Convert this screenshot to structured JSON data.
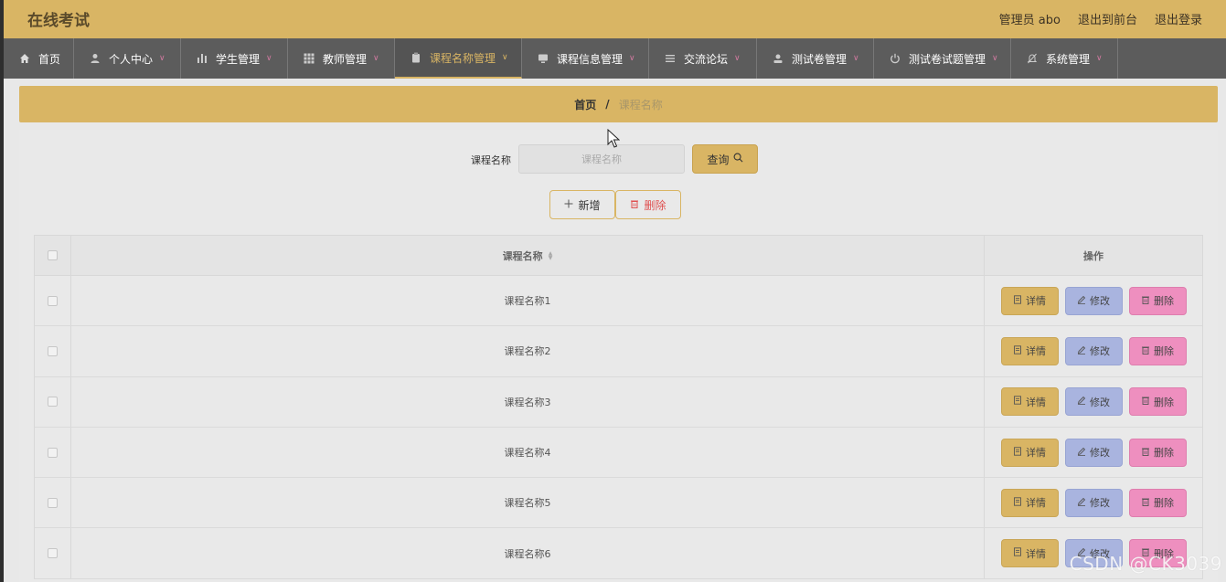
{
  "header": {
    "title": "在线考试",
    "user_label": "管理员 abo",
    "back_label": "退出到前台",
    "logout_label": "退出登录"
  },
  "nav": {
    "items": [
      {
        "label": "首页",
        "icon": "home-icon"
      },
      {
        "label": "个人中心",
        "icon": "person-icon"
      },
      {
        "label": "学生管理",
        "icon": "bar-chart-icon"
      },
      {
        "label": "教师管理",
        "icon": "grid-icon"
      },
      {
        "label": "课程名称管理",
        "icon": "clipboard-icon"
      },
      {
        "label": "课程信息管理",
        "icon": "monitor-icon"
      },
      {
        "label": "交流论坛",
        "icon": "list-icon"
      },
      {
        "label": "测试卷管理",
        "icon": "user-icon"
      },
      {
        "label": "测试卷试题管理",
        "icon": "power-icon"
      },
      {
        "label": "系统管理",
        "icon": "bell-off-icon"
      }
    ],
    "active_index": 4
  },
  "breadcrumb": {
    "home": "首页",
    "separator": "/",
    "current": "课程名称"
  },
  "search": {
    "label": "课程名称",
    "placeholder": "课程名称",
    "button_label": "查询"
  },
  "actions": {
    "add_label": "新增",
    "delete_label": "删除"
  },
  "table": {
    "columns": [
      "课程名称",
      "操作"
    ],
    "rows": [
      {
        "name": "课程名称1"
      },
      {
        "name": "课程名称2"
      },
      {
        "name": "课程名称3"
      },
      {
        "name": "课程名称4"
      },
      {
        "name": "课程名称5"
      },
      {
        "name": "课程名称6"
      }
    ],
    "row_actions": {
      "detail": "详情",
      "edit": "修改",
      "delete": "删除"
    }
  },
  "watermark": "CSDN @CK3039",
  "colors": {
    "accent": "#d9b564",
    "nav_bg": "#5c5c5c",
    "detail_btn": "#d9b564",
    "edit_btn": "#a9b4df",
    "delete_btn": "#ee8fbf"
  }
}
